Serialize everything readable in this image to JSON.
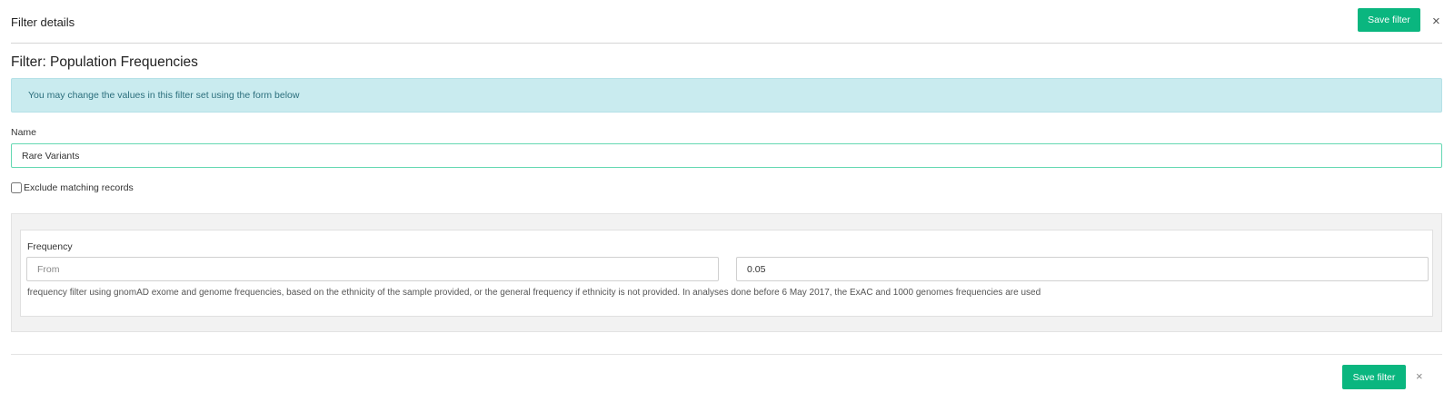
{
  "header": {
    "title": "Filter details",
    "save_label": "Save filter",
    "close_label": "×"
  },
  "filter": {
    "heading": "Filter: Population Frequencies",
    "info_message": "You may change the values in this filter set using the form below"
  },
  "form": {
    "name_label": "Name",
    "name_value": "Rare Variants",
    "exclude_label": "Exclude matching records",
    "exclude_checked": false,
    "frequency": {
      "label": "Frequency",
      "from_placeholder": "From",
      "from_value": "",
      "to_value": "0.05",
      "help_text": "frequency filter using gnomAD exome and genome frequencies, based on the ethnicity of the sample provided, or the general frequency if ethnicity is not provided. In analyses done before 6 May 2017, the ExAC and 1000 genomes frequencies are used"
    }
  },
  "footer": {
    "save_label": "Save filter",
    "close_label": "×"
  },
  "colors": {
    "primary": "#0ab67f",
    "info_bg": "#c9ebef",
    "info_text": "#2b6e7c",
    "focus_border": "#64d8b2"
  }
}
